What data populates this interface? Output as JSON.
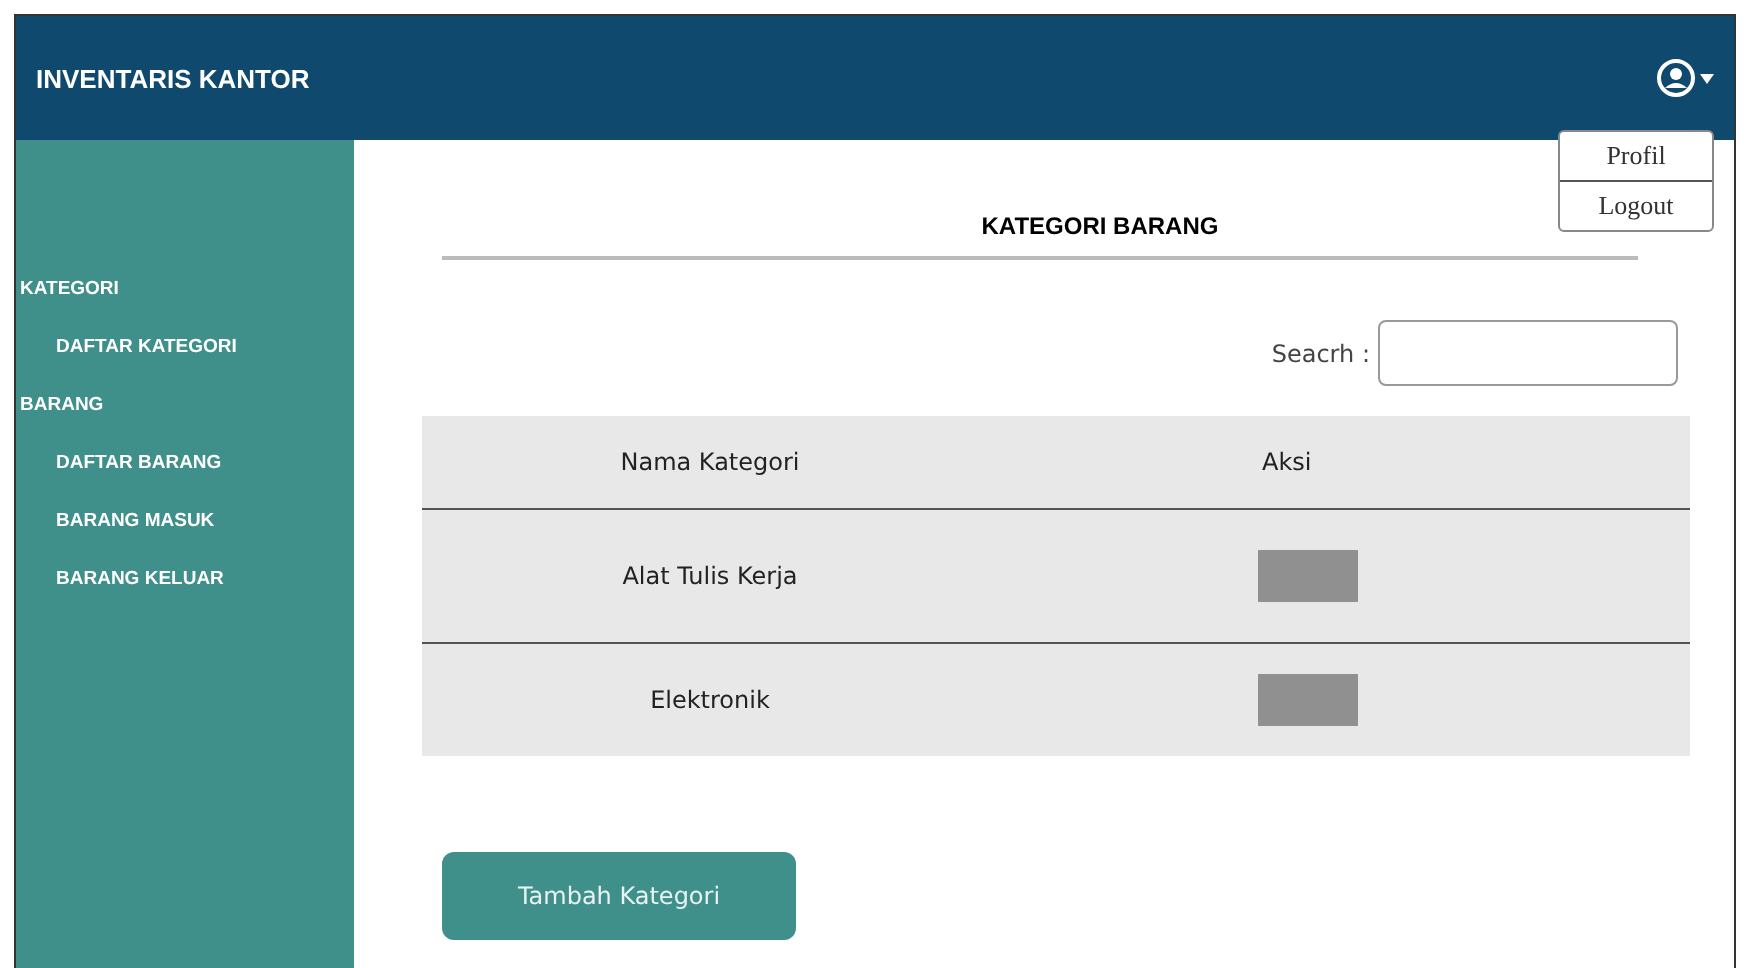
{
  "header": {
    "title": "INVENTARIS KANTOR"
  },
  "user_menu": {
    "expanded": true,
    "items": [
      "Profil",
      "Logout"
    ]
  },
  "sidebar": {
    "items": [
      {
        "label": "KATEGORI",
        "children": [
          {
            "label": "DAFTAR KATEGORI"
          }
        ]
      },
      {
        "label": "BARANG",
        "children": [
          {
            "label": "DAFTAR BARANG"
          },
          {
            "label": "BARANG MASUK"
          },
          {
            "label": "BARANG KELUAR"
          }
        ]
      }
    ]
  },
  "page_title": "KATEGORI BARANG",
  "search": {
    "label": "Seacrh :"
  },
  "table": {
    "columns": [
      "Nama Kategori",
      "Aksi"
    ],
    "rows": [
      {
        "name": "Alat Tulis Kerja"
      },
      {
        "name": "Elektronik"
      }
    ]
  },
  "add_button": "Tambah Kategori"
}
